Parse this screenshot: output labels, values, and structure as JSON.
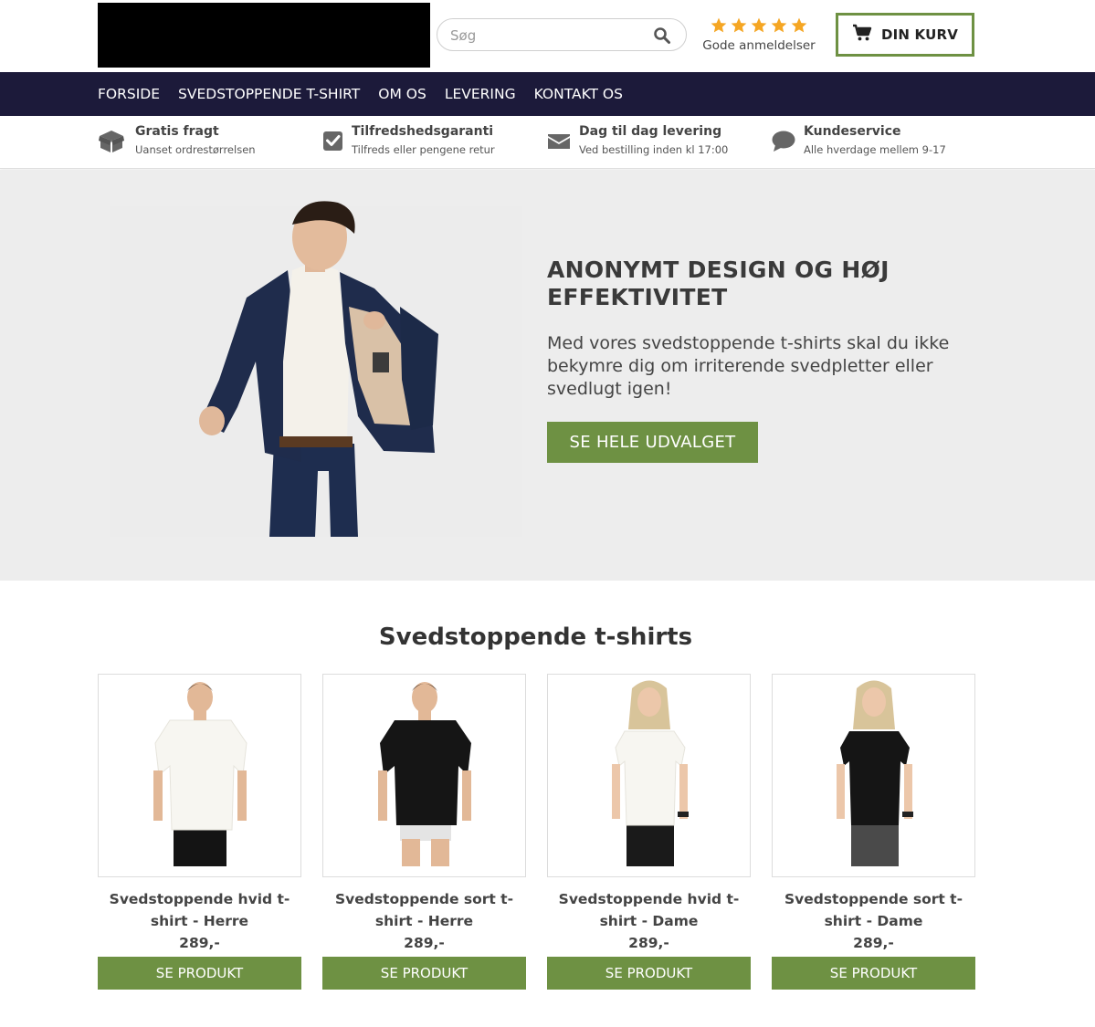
{
  "header": {
    "search_placeholder": "Søg",
    "rating_text": "Gode anmeldelser",
    "rating_stars": 5,
    "cart_label": "DIN KURV"
  },
  "nav": {
    "items": [
      "FORSIDE",
      "SVEDSTOPPENDE T-SHIRT",
      "OM OS",
      "LEVERING",
      "KONTAKT OS"
    ]
  },
  "usp": [
    {
      "title": "Gratis fragt",
      "subtitle": "Uanset ordrestørrelsen",
      "icon": "box-icon"
    },
    {
      "title": "Tilfredshedsgaranti",
      "subtitle": "Tilfreds eller pengene retur",
      "icon": "checkbox-icon"
    },
    {
      "title": "Dag til dag levering",
      "subtitle": "Ved bestilling inden kl 17:00",
      "icon": "envelope-icon"
    },
    {
      "title": "Kundeservice",
      "subtitle": "Alle hverdage mellem 9-17",
      "icon": "chat-bubble-icon"
    }
  ],
  "hero": {
    "title": "ANONYMT DESIGN OG HØJ EFFEKTIVITET",
    "text": "Med vores svedstoppende t-shirts skal du ikke bekymre dig om irriterende svedpletter eller svedlugt igen!",
    "button": "SE HELE UDVALGET"
  },
  "products": {
    "title": "Svedstoppende t-shirts",
    "items": [
      {
        "name": "Svedstoppende hvid t-shirt - Herre",
        "price": "289,-",
        "button": "SE PRODUKT"
      },
      {
        "name": "Svedstoppende sort t-shirt - Herre",
        "price": "289,-",
        "button": "SE PRODUKT"
      },
      {
        "name": "Svedstoppende hvid t-shirt - Dame",
        "price": "289,-",
        "button": "SE PRODUKT"
      },
      {
        "name": "Svedstoppende sort t-shirt - Dame",
        "price": "289,-",
        "button": "SE PRODUKT"
      }
    ]
  },
  "colors": {
    "accent_green": "#6e9143",
    "nav_dark": "#1c1a3a",
    "star_orange": "#f5a623"
  }
}
